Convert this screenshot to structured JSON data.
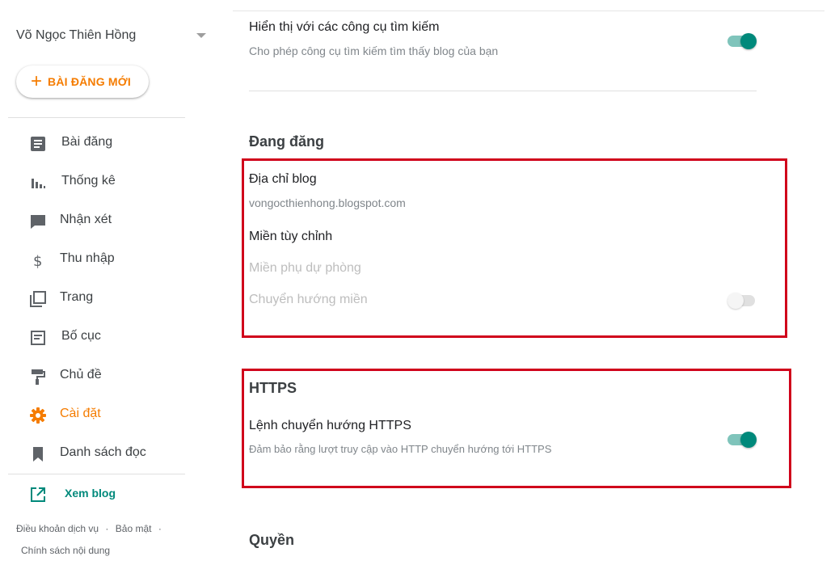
{
  "sidebar": {
    "blog_name": "Võ Ngọc Thiên Hồng",
    "new_post_label": "BÀI ĐĂNG MỚI",
    "items": [
      {
        "label": "Bài đăng",
        "icon": "posts-icon"
      },
      {
        "label": "Thống kê",
        "icon": "stats-icon"
      },
      {
        "label": "Nhận xét",
        "icon": "comments-icon"
      },
      {
        "label": "Thu nhập",
        "icon": "dollar-icon"
      },
      {
        "label": "Trang",
        "icon": "pages-icon"
      },
      {
        "label": "Bố cục",
        "icon": "layout-icon"
      },
      {
        "label": "Chủ đề",
        "icon": "paint-roller-icon"
      },
      {
        "label": "Cài đặt",
        "icon": "gear-icon",
        "active": true
      },
      {
        "label": "Danh sách đọc",
        "icon": "bookmark-icon"
      }
    ],
    "view_blog_label": "Xem blog",
    "footer": {
      "terms": "Điều khoản dịch vụ",
      "privacy": "Bảo mật",
      "content_policy": "Chính sách nội dung",
      "separator": "·"
    }
  },
  "main": {
    "search_engines": {
      "title": "Hiển thị với các công cụ tìm kiếm",
      "description": "Cho phép công cụ tìm kiếm tìm thấy blog của bạn",
      "enabled": true
    },
    "publishing": {
      "heading": "Đang đăng",
      "blog_address_title": "Địa chỉ blog",
      "blog_address_value": "vongocthienhong.blogspot.com",
      "custom_domain_title": "Miền tùy chỉnh",
      "fallback_subdomain_title": "Miền phụ dự phòng",
      "domain_redirect_title": "Chuyển hướng miền",
      "domain_redirect_enabled": false
    },
    "https": {
      "heading": "HTTPS",
      "redirect_title": "Lệnh chuyển hướng HTTPS",
      "redirect_description": "Đảm bảo rằng lượt truy cập vào HTTP chuyển hướng tới HTTPS",
      "redirect_enabled": true
    },
    "permissions": {
      "heading": "Quyền"
    }
  },
  "colors": {
    "accent_orange": "#f57c00",
    "toggle_teal": "#00897b",
    "highlight_red": "#d0021b"
  }
}
